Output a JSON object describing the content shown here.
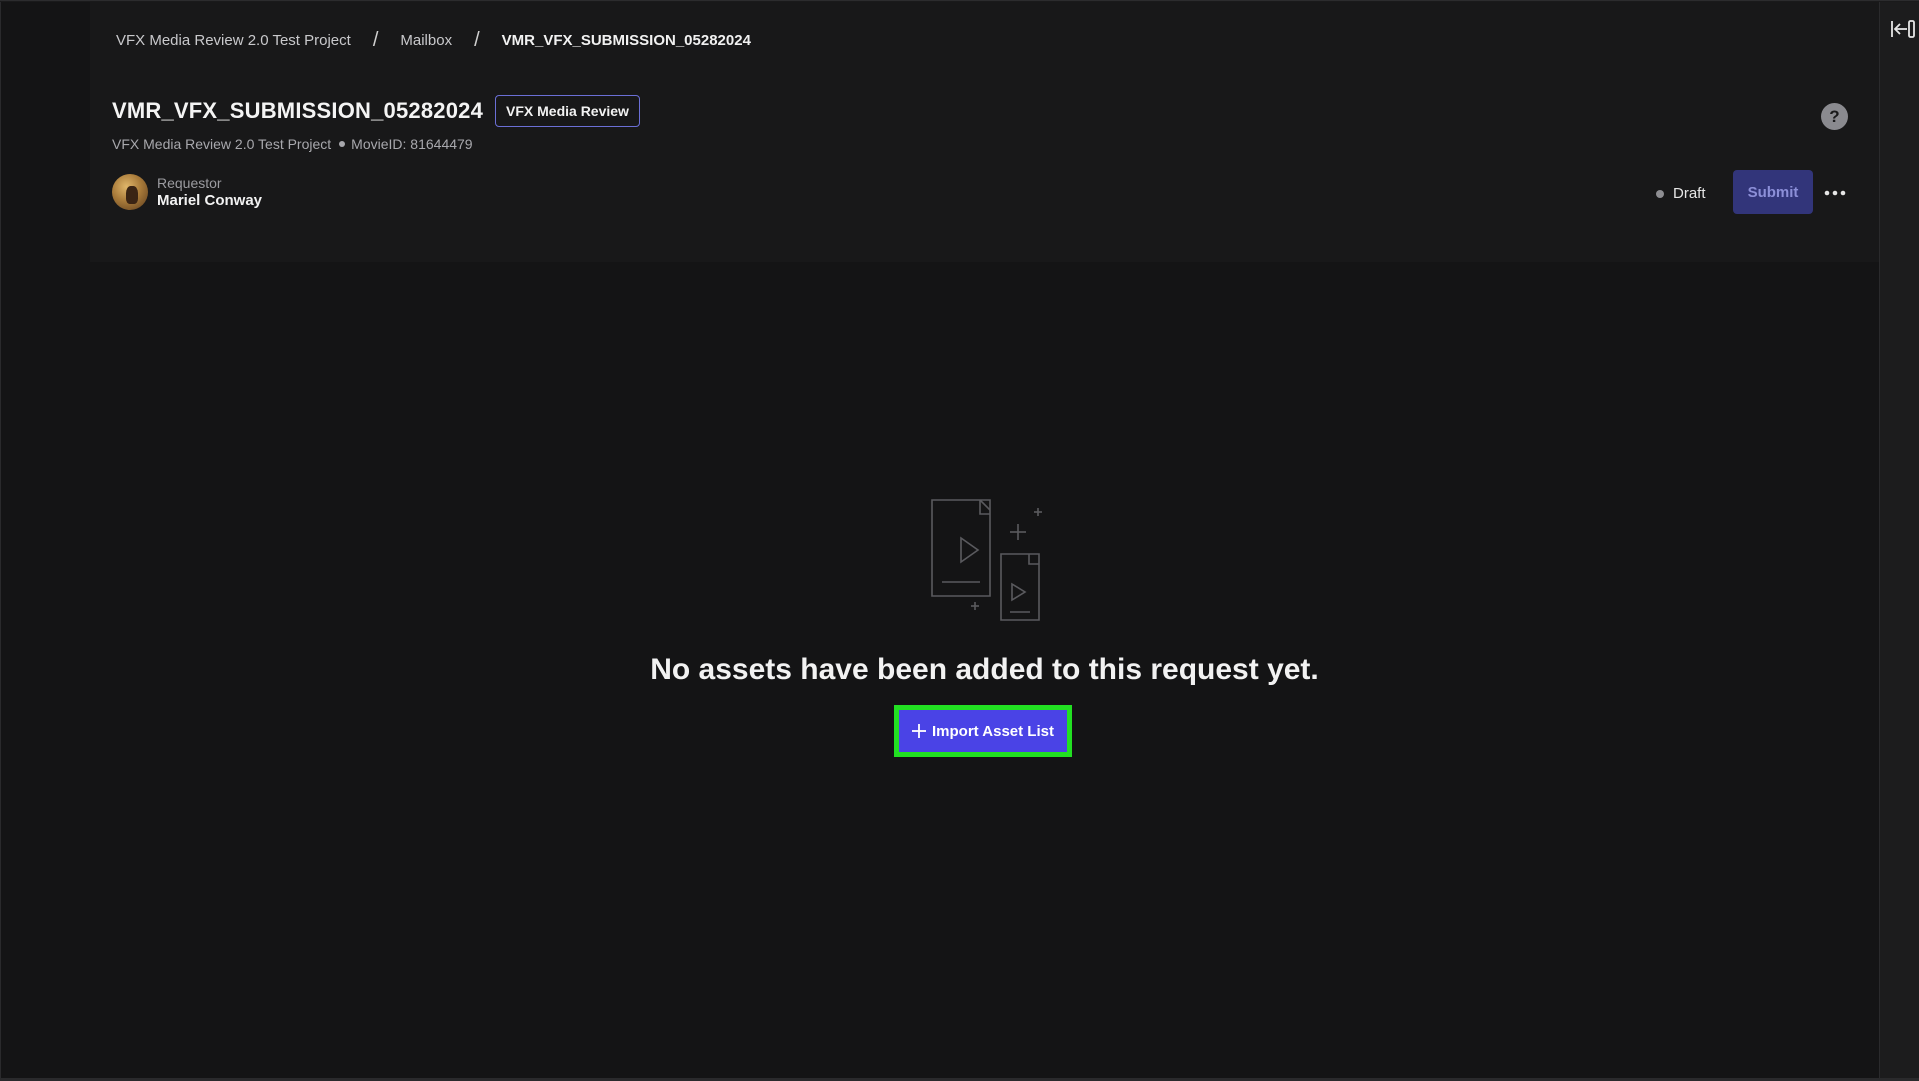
{
  "breadcrumb": {
    "project": "VFX Media Review 2.0 Test Project",
    "mailbox": "Mailbox",
    "current": "VMR_VFX_SUBMISSION_05282024",
    "separator": "/"
  },
  "request": {
    "title": "VMR_VFX_SUBMISSION_05282024",
    "type_badge": "VFX Media Review",
    "project": "VFX Media Review 2.0 Test Project",
    "movie_id": "MovieID: 81644479"
  },
  "requestor": {
    "label": "Requestor",
    "name": "Mariel Conway"
  },
  "status": {
    "label": "Draft"
  },
  "actions": {
    "submit_label": "Submit",
    "help_label": "?"
  },
  "empty_state": {
    "message": "No assets have been added to this request yet.",
    "import_label": "Import Asset List"
  },
  "colors": {
    "accent": "#4a43e6",
    "submit_disabled": "#32357a",
    "highlight": "#22e022"
  }
}
